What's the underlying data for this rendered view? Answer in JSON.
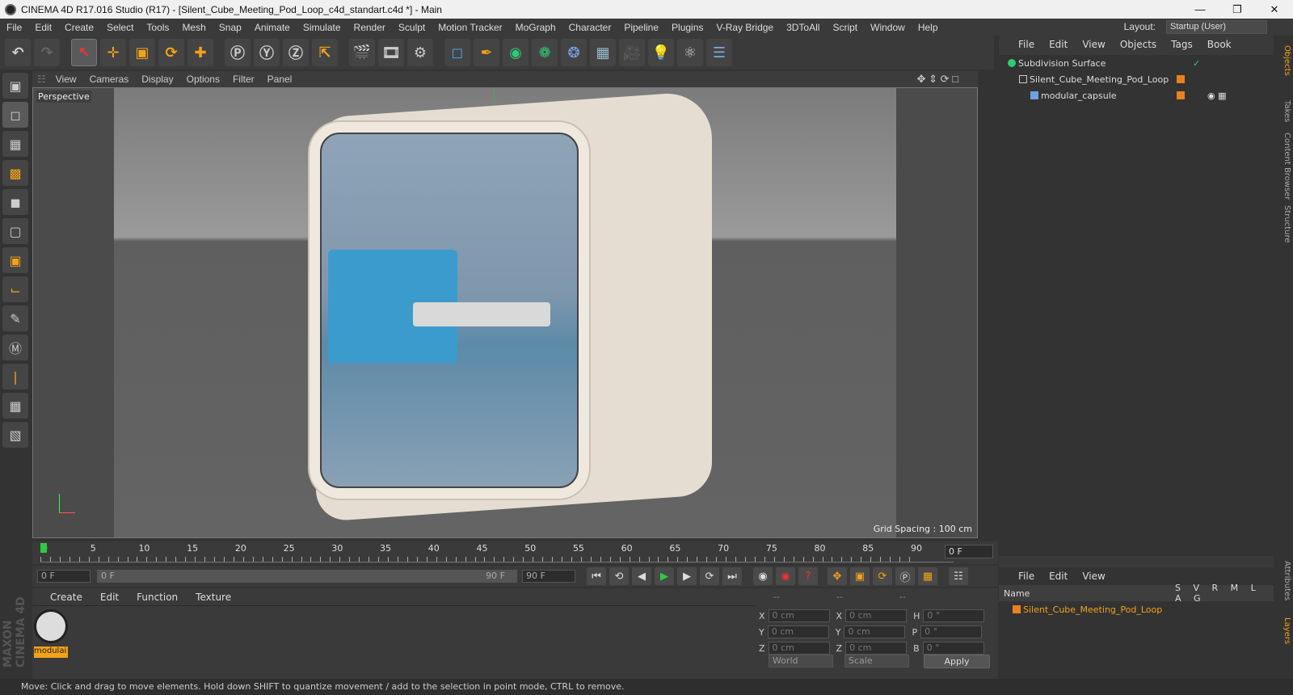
{
  "window": {
    "title": "CINEMA 4D R17.016 Studio (R17) - [Silent_Cube_Meeting_Pod_Loop_c4d_standart.c4d *] - Main"
  },
  "menu": [
    "File",
    "Edit",
    "Create",
    "Select",
    "Tools",
    "Mesh",
    "Snap",
    "Animate",
    "Simulate",
    "Render",
    "Sculpt",
    "Motion Tracker",
    "MoGraph",
    "Character",
    "Pipeline",
    "Plugins",
    "V-Ray Bridge",
    "3DToAll",
    "Script",
    "Window",
    "Help"
  ],
  "layout": {
    "label": "Layout:",
    "value": "Startup (User)"
  },
  "viewport": {
    "menu": [
      "View",
      "Cameras",
      "Display",
      "Options",
      "Filter",
      "Panel"
    ],
    "camera_label": "Perspective",
    "grid_spacing": "Grid Spacing : 100 cm"
  },
  "timeline": {
    "ticks": [
      "0",
      "5",
      "10",
      "15",
      "20",
      "25",
      "30",
      "35",
      "40",
      "45",
      "50",
      "55",
      "60",
      "65",
      "70",
      "75",
      "80",
      "85",
      "90"
    ],
    "current_frame": "0 F"
  },
  "playbar": {
    "start": "0 F",
    "range_start": "0 F",
    "range_end": "90 F",
    "end": "90 F"
  },
  "material_manager": {
    "menu": [
      "Create",
      "Edit",
      "Function",
      "Texture"
    ],
    "material_name": "modulai"
  },
  "coordinates": {
    "headers": [
      "--",
      "--",
      "--"
    ],
    "x_pos": "0 cm",
    "y_pos": "0 cm",
    "z_pos": "0 cm",
    "x_size": "0 cm",
    "y_size": "0 cm",
    "z_size": "0 cm",
    "h": "0 °",
    "p": "0 °",
    "b": "0 °",
    "labels": {
      "x": "X",
      "y": "Y",
      "z": "Z",
      "h": "H",
      "p": "P",
      "b": "B"
    },
    "world_mode": "World",
    "scale_mode": "Scale",
    "apply": "Apply"
  },
  "object_manager": {
    "menu": [
      "File",
      "Edit",
      "View",
      "Objects",
      "Tags",
      "Book"
    ],
    "objects": [
      {
        "name": "Subdivision Surface",
        "indent": 0
      },
      {
        "name": "Silent_Cube_Meeting_Pod_Loop",
        "indent": 1
      },
      {
        "name": "modular_capsule",
        "indent": 2
      }
    ]
  },
  "layer_manager": {
    "menu": [
      "File",
      "Edit",
      "View"
    ],
    "columns": {
      "name": "Name",
      "flags": [
        "S",
        "V",
        "R",
        "M",
        "L",
        "A",
        "G"
      ]
    },
    "layers": [
      {
        "name": "Silent_Cube_Meeting_Pod_Loop",
        "color": "#e8821e"
      }
    ]
  },
  "side_tabs": [
    "Objects",
    "Takes",
    "Content Browser",
    "Structure",
    "Attributes",
    "Layers"
  ],
  "status": "Move: Click and drag to move elements. Hold down SHIFT to quantize movement / add to the selection in point mode, CTRL to remove.",
  "branding": "MAXON CINEMA 4D",
  "colors": {
    "accent": "#f3a21a",
    "selected_tool": "#5a5a5a",
    "green_play": "#2ecc40"
  }
}
